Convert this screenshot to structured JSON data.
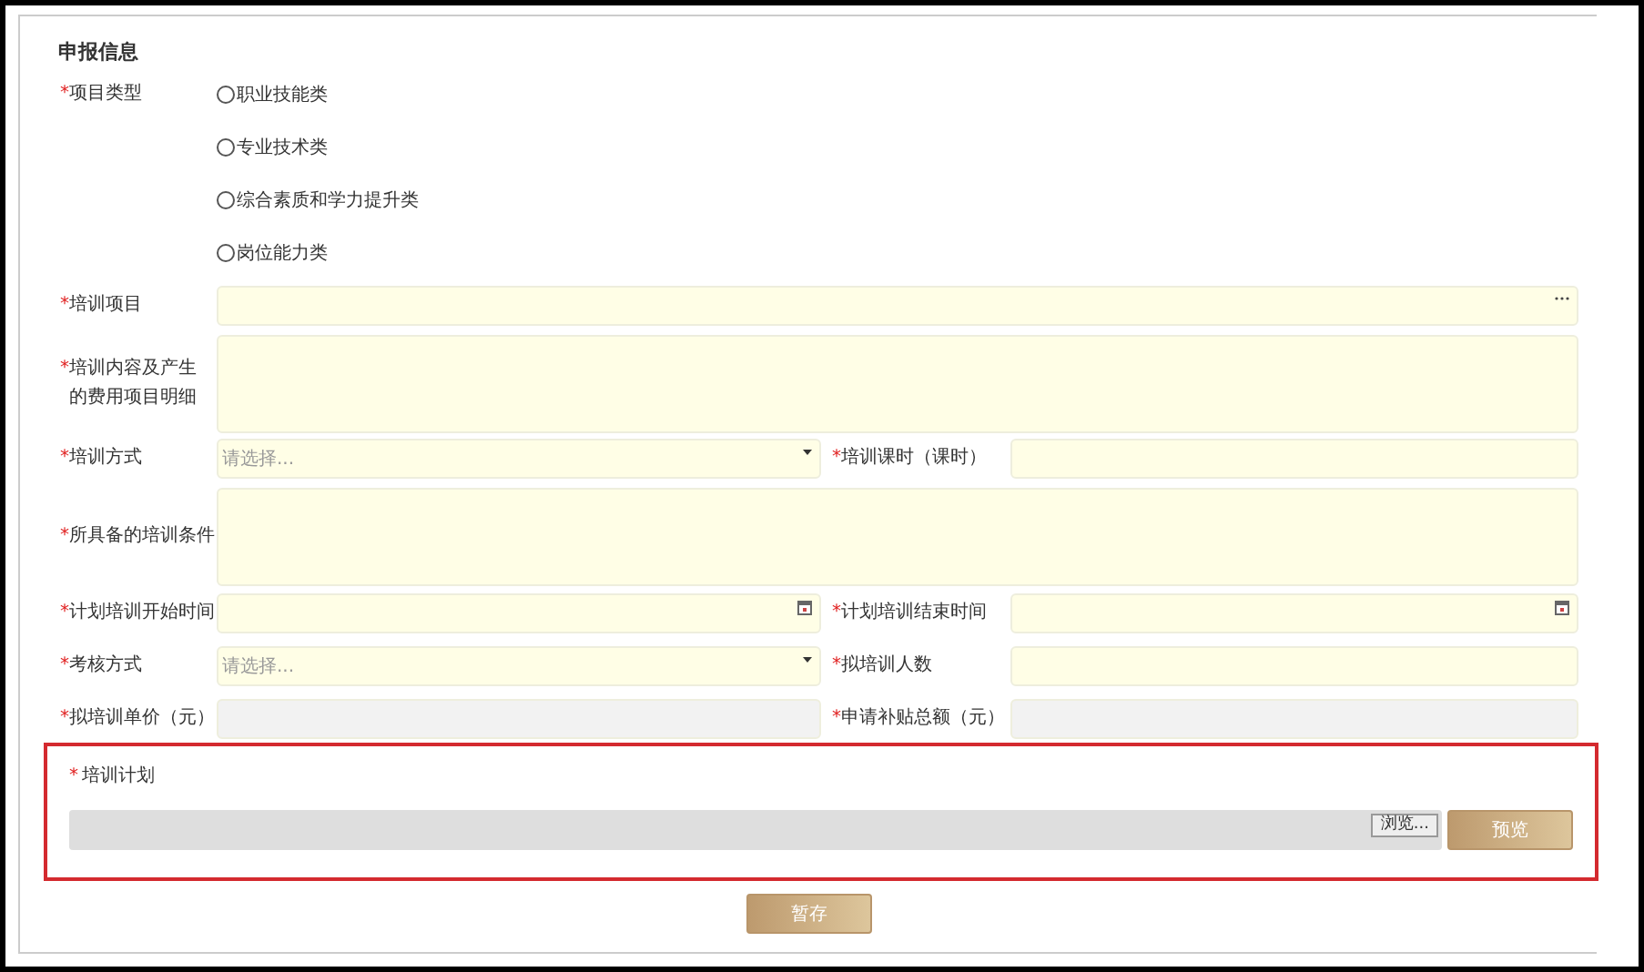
{
  "form": {
    "title": "申报信息",
    "project_type": {
      "mark": "*",
      "label": "项目类型",
      "options": [
        {
          "label": "职业技能类",
          "selected": false
        },
        {
          "label": "专业技术类",
          "selected": false
        },
        {
          "label": "综合素质和学力提升类",
          "selected": false
        },
        {
          "label": "岗位能力类",
          "selected": false
        }
      ]
    },
    "rows": [
      [
        {
          "mark": "*",
          "label": "培训项目",
          "kind": "picker"
        }
      ],
      [
        {
          "mark": "*",
          "label": "培训内容及产生的费用项目明细",
          "kind": "textarea"
        }
      ],
      [
        {
          "mark": "*",
          "label": "培训方式",
          "kind": "select",
          "placeholder": "请选择..."
        },
        {
          "mark": "*",
          "label": "培训课时（课时）",
          "kind": "text"
        }
      ],
      [
        {
          "mark": "*",
          "label": "所具备的培训条件",
          "kind": "textarea"
        }
      ],
      [
        {
          "mark": "*",
          "label": "计划培训开始时间",
          "kind": "date"
        },
        {
          "mark": "*",
          "label": "计划培训结束时间",
          "kind": "date"
        }
      ],
      [
        {
          "mark": "*",
          "label": "考核方式",
          "kind": "select",
          "placeholder": "请选择..."
        },
        {
          "mark": "*",
          "label": "拟培训人数",
          "kind": "text"
        }
      ],
      [
        {
          "mark": "*",
          "label": "拟培训单价（元）",
          "kind": "readonly"
        },
        {
          "mark": "*",
          "label": "申请补贴总额（元）",
          "kind": "readonly"
        }
      ]
    ],
    "upload": {
      "mark": "*",
      "label": "培训计划",
      "browse": "浏览...",
      "preview": "预览"
    },
    "save": "暂存"
  }
}
